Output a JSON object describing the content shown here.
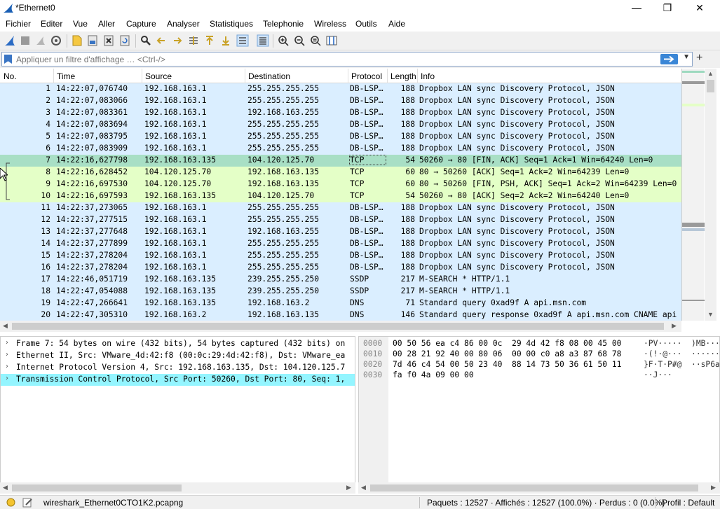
{
  "window": {
    "title": "*Ethernet0",
    "minimize": "—",
    "maximize": "❐",
    "close": "✕"
  },
  "menu": [
    "Fichier",
    "Editer",
    "Vue",
    "Aller",
    "Capture",
    "Analyser",
    "Statistiques",
    "Telephonie",
    "Wireless",
    "Outils",
    "Aide"
  ],
  "filter": {
    "placeholder": "Appliquer un filtre d'affichage … <Ctrl-/>",
    "plus": "+"
  },
  "columns": {
    "no": "No.",
    "time": "Time",
    "source": "Source",
    "destination": "Destination",
    "protocol": "Protocol",
    "length": "Length",
    "info": "Info"
  },
  "packets": [
    {
      "no": "1",
      "time": "14:22:07,076740",
      "src": "192.168.163.1",
      "dst": "255.255.255.255",
      "proto": "DB-LSP…",
      "len": "188",
      "info": "Dropbox LAN sync Discovery Protocol, JSON",
      "kind": "udp"
    },
    {
      "no": "2",
      "time": "14:22:07,083066",
      "src": "192.168.163.1",
      "dst": "255.255.255.255",
      "proto": "DB-LSP…",
      "len": "188",
      "info": "Dropbox LAN sync Discovery Protocol, JSON",
      "kind": "udp"
    },
    {
      "no": "3",
      "time": "14:22:07,083361",
      "src": "192.168.163.1",
      "dst": "192.168.163.255",
      "proto": "DB-LSP…",
      "len": "188",
      "info": "Dropbox LAN sync Discovery Protocol, JSON",
      "kind": "udp"
    },
    {
      "no": "4",
      "time": "14:22:07,083694",
      "src": "192.168.163.1",
      "dst": "255.255.255.255",
      "proto": "DB-LSP…",
      "len": "188",
      "info": "Dropbox LAN sync Discovery Protocol, JSON",
      "kind": "udp"
    },
    {
      "no": "5",
      "time": "14:22:07,083795",
      "src": "192.168.163.1",
      "dst": "255.255.255.255",
      "proto": "DB-LSP…",
      "len": "188",
      "info": "Dropbox LAN sync Discovery Protocol, JSON",
      "kind": "udp"
    },
    {
      "no": "6",
      "time": "14:22:07,083909",
      "src": "192.168.163.1",
      "dst": "255.255.255.255",
      "proto": "DB-LSP…",
      "len": "188",
      "info": "Dropbox LAN sync Discovery Protocol, JSON",
      "kind": "udp"
    },
    {
      "no": "7",
      "time": "14:22:16,627798",
      "src": "192.168.163.135",
      "dst": "104.120.125.70",
      "proto": "TCP",
      "len": "54",
      "info": "50260 → 80 [FIN, ACK] Seq=1 Ack=1 Win=64240 Len=0",
      "kind": "sel"
    },
    {
      "no": "8",
      "time": "14:22:16,628452",
      "src": "104.120.125.70",
      "dst": "192.168.163.135",
      "proto": "TCP",
      "len": "60",
      "info": "80 → 50260 [ACK] Seq=1 Ack=2 Win=64239 Len=0",
      "kind": "tcp"
    },
    {
      "no": "9",
      "time": "14:22:16,697530",
      "src": "104.120.125.70",
      "dst": "192.168.163.135",
      "proto": "TCP",
      "len": "60",
      "info": "80 → 50260 [FIN, PSH, ACK] Seq=1 Ack=2 Win=64239 Len=0",
      "kind": "tcp"
    },
    {
      "no": "10",
      "time": "14:22:16,697593",
      "src": "192.168.163.135",
      "dst": "104.120.125.70",
      "proto": "TCP",
      "len": "54",
      "info": "50260 → 80 [ACK] Seq=2 Ack=2 Win=64240 Len=0",
      "kind": "tcp"
    },
    {
      "no": "11",
      "time": "14:22:37,273065",
      "src": "192.168.163.1",
      "dst": "255.255.255.255",
      "proto": "DB-LSP…",
      "len": "188",
      "info": "Dropbox LAN sync Discovery Protocol, JSON",
      "kind": "udp"
    },
    {
      "no": "12",
      "time": "14:22:37,277515",
      "src": "192.168.163.1",
      "dst": "255.255.255.255",
      "proto": "DB-LSP…",
      "len": "188",
      "info": "Dropbox LAN sync Discovery Protocol, JSON",
      "kind": "udp"
    },
    {
      "no": "13",
      "time": "14:22:37,277648",
      "src": "192.168.163.1",
      "dst": "192.168.163.255",
      "proto": "DB-LSP…",
      "len": "188",
      "info": "Dropbox LAN sync Discovery Protocol, JSON",
      "kind": "udp"
    },
    {
      "no": "14",
      "time": "14:22:37,277899",
      "src": "192.168.163.1",
      "dst": "255.255.255.255",
      "proto": "DB-LSP…",
      "len": "188",
      "info": "Dropbox LAN sync Discovery Protocol, JSON",
      "kind": "udp"
    },
    {
      "no": "15",
      "time": "14:22:37,278204",
      "src": "192.168.163.1",
      "dst": "255.255.255.255",
      "proto": "DB-LSP…",
      "len": "188",
      "info": "Dropbox LAN sync Discovery Protocol, JSON",
      "kind": "udp"
    },
    {
      "no": "16",
      "time": "14:22:37,278204",
      "src": "192.168.163.1",
      "dst": "255.255.255.255",
      "proto": "DB-LSP…",
      "len": "188",
      "info": "Dropbox LAN sync Discovery Protocol, JSON",
      "kind": "udp"
    },
    {
      "no": "17",
      "time": "14:22:46,051719",
      "src": "192.168.163.135",
      "dst": "239.255.255.250",
      "proto": "SSDP",
      "len": "217",
      "info": "M-SEARCH * HTTP/1.1",
      "kind": "udp"
    },
    {
      "no": "18",
      "time": "14:22:47,054088",
      "src": "192.168.163.135",
      "dst": "239.255.255.250",
      "proto": "SSDP",
      "len": "217",
      "info": "M-SEARCH * HTTP/1.1",
      "kind": "udp"
    },
    {
      "no": "19",
      "time": "14:22:47,266641",
      "src": "192.168.163.135",
      "dst": "192.168.163.2",
      "proto": "DNS",
      "len": "71",
      "info": "Standard query 0xad9f A api.msn.com",
      "kind": "udp"
    },
    {
      "no": "20",
      "time": "14:22:47,305310",
      "src": "192.168.163.2",
      "dst": "192.168.163.135",
      "proto": "DNS",
      "len": "146",
      "info": "Standard query response 0xad9f A api.msn.com CNAME api",
      "kind": "udp"
    }
  ],
  "details": [
    {
      "text": "Frame 7: 54 bytes on wire (432 bits), 54 bytes captured (432 bits) on",
      "selected": false
    },
    {
      "text": "Ethernet II, Src: VMware_4d:42:f8 (00:0c:29:4d:42:f8), Dst: VMware_ea",
      "selected": false
    },
    {
      "text": "Internet Protocol Version 4, Src: 192.168.163.135, Dst: 104.120.125.7",
      "selected": false
    },
    {
      "text": "Transmission Control Protocol, Src Port: 50260, Dst Port: 80, Seq: 1,",
      "selected": true
    }
  ],
  "hex": [
    {
      "off": "0000",
      "bytes": "00 50 56 ea c4 86 00 0c  29 4d 42 f8 08 00 45 00",
      "ascii": "·PV·····  )MB···"
    },
    {
      "off": "0010",
      "bytes": "00 28 21 92 40 00 80 06  00 00 c0 a8 a3 87 68 78",
      "ascii": "·(!·@···  ······"
    },
    {
      "off": "0020",
      "bytes": "7d 46 c4 54 00 50 23 40  88 14 73 50 36 61 50 11",
      "ascii": "}F·T·P#@  ··sP6a"
    },
    {
      "off": "0030",
      "bytes": "fa f0 4a 09 00 00",
      "ascii": "··J···"
    }
  ],
  "status": {
    "file": "wireshark_Ethernet0CTO1K2.pcapng",
    "stats": "Paquets : 12527 · Affichés : 12527 (100.0%) · Perdus : 0 (0.0%)",
    "profile": "Profil : Default"
  },
  "colors": {
    "udp": "#daeeff",
    "tcp": "#e4ffc7",
    "selected": "#a8dfc5",
    "detail_selected": "#94f5ff"
  }
}
